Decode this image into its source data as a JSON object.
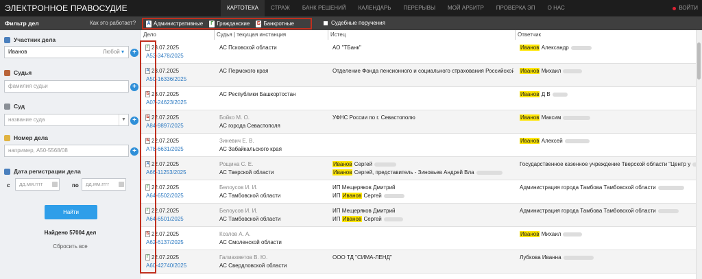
{
  "app": {
    "title": "ЭЛЕКТРОННОЕ ПРАВОСУДИЕ",
    "login": "ВОЙТИ"
  },
  "nav": [
    "КАРТОТЕКА",
    "СТРАЖ",
    "БАНК РЕШЕНИЙ",
    "КАЛЕНДАРЬ",
    "ПЕРЕРЫВЫ",
    "МОЙ АРБИТР",
    "ПРОВЕРКА ЭП",
    "О НАС"
  ],
  "subbar": {
    "filter_title": "Фильтр дел",
    "how_it_works": "Как это работает?",
    "types": [
      {
        "label": "Административные",
        "icon": "А",
        "color": "#2f6fb5"
      },
      {
        "label": "Гражданские",
        "icon": "Г",
        "color": "#3a9a3a"
      },
      {
        "label": "Банкротные",
        "icon": "Б",
        "color": "#c0301f"
      }
    ],
    "court_orders": "Судебные поручения"
  },
  "filters": {
    "participant_label": "Участник дела",
    "participant_value": "Иванов",
    "participant_role": "Любой",
    "judge_label": "Судья",
    "judge_placeholder": "фамилия судьи",
    "court_label": "Суд",
    "court_placeholder": "название суда",
    "case_number_label": "Номер дела",
    "case_number_placeholder": "например, А50-5568/08",
    "reg_date_label": "Дата регистрации дела",
    "from_label": "с",
    "to_label": "по",
    "date_placeholder": "дд.мм.гггг",
    "find_button": "Найти",
    "found_text": "Найдено 57004 дел",
    "reset_text": "Сбросить все"
  },
  "table": {
    "headers": [
      "Дело",
      "Судья | текущая инстанция",
      "Истец",
      "Ответчик"
    ],
    "rows": [
      {
        "type": "Г",
        "date": "23.07.2025",
        "number": "А52-3478/2025",
        "judge": "",
        "court": "АС Псковской области",
        "plaintiff": [
          {
            "pre": "АО \"ТБанк\"",
            "hl": "",
            "post": ""
          }
        ],
        "defendant": [
          {
            "pre": "",
            "hl": "Иванов",
            "post": " Александр"
          }
        ]
      },
      {
        "type": "А",
        "date": "23.07.2025",
        "number": "А50-16336/2025",
        "judge": "",
        "court": "АС Пермского края",
        "plaintiff": [
          {
            "pre": "Отделение Фонда пенсионного и социального страхования Российской",
            "hl": "",
            "post": ""
          }
        ],
        "defendant": [
          {
            "pre": "",
            "hl": "Иванов",
            "post": " Михаил"
          }
        ]
      },
      {
        "type": "Б",
        "date": "23.07.2025",
        "number": "А07-24623/2025",
        "judge": "",
        "court": "АС Республики Башкортостан",
        "plaintiff": [],
        "defendant": [
          {
            "pre": "",
            "hl": "Иванов",
            "post": " Д В"
          }
        ]
      },
      {
        "type": "Б",
        "date": "22.07.2025",
        "number": "А84-9897/2025",
        "judge": "Бойко М. О.",
        "court": "АС города Севастополя",
        "plaintiff": [
          {
            "pre": "УФНС России по г. Севастополю",
            "hl": "",
            "post": ""
          }
        ],
        "defendant": [
          {
            "pre": "",
            "hl": "Иванов",
            "post": " Максим"
          }
        ]
      },
      {
        "type": "Б",
        "date": "22.07.2025",
        "number": "А78-6631/2025",
        "judge": "Зиневич Е. В.",
        "court": "АС Забайкальского края",
        "plaintiff": [],
        "defendant": [
          {
            "pre": "",
            "hl": "Иванов",
            "post": " Алексей"
          }
        ]
      },
      {
        "type": "А",
        "date": "22.07.2025",
        "number": "А66-11253/2025",
        "judge": "Рощина С. Е.",
        "court": "АС Тверской области",
        "plaintiff": [
          {
            "pre": "",
            "hl": "Иванов",
            "post": " Сергей"
          },
          {
            "pre": "",
            "hl": "Иванов",
            "post": " Сергей, представитель - Зиновьев Андрей Вла"
          }
        ],
        "defendant": [
          {
            "pre": "Государственное казенное учреждение Тверской области \"Центр у",
            "hl": "",
            "post": ""
          }
        ]
      },
      {
        "type": "Г",
        "date": "22.07.2025",
        "number": "А64-6502/2025",
        "judge": "Белоусов И. И.",
        "court": "АС Тамбовской области",
        "plaintiff": [
          {
            "pre": "ИП Мещеряков Дмитрий",
            "hl": "",
            "post": ""
          },
          {
            "pre": "ИП ",
            "hl": "Иванов",
            "post": " Сергей"
          }
        ],
        "defendant": [
          {
            "pre": "Администрация города Тамбова Тамбовской области",
            "hl": "",
            "post": ""
          }
        ]
      },
      {
        "type": "Г",
        "date": "22.07.2025",
        "number": "А64-6501/2025",
        "judge": "Белоусов И. И.",
        "court": "АС Тамбовской области",
        "plaintiff": [
          {
            "pre": "ИП Мещеряков Дмитрий",
            "hl": "",
            "post": ""
          },
          {
            "pre": "ИП ",
            "hl": "Иванов",
            "post": " Сергей"
          }
        ],
        "defendant": [
          {
            "pre": "Администрация города Тамбова Тамбовской области",
            "hl": "",
            "post": ""
          }
        ]
      },
      {
        "type": "Б",
        "date": "22.07.2025",
        "number": "А62-6137/2025",
        "judge": "Козлов А. А.",
        "court": "АС Смоленской области",
        "plaintiff": [],
        "defendant": [
          {
            "pre": "",
            "hl": "Иванов",
            "post": " Михаил"
          }
        ]
      },
      {
        "type": "Г",
        "date": "22.07.2025",
        "number": "А60-42740/2025",
        "judge": "Галиахметов В. Ю.",
        "court": "АС Свердловской области",
        "plaintiff": [
          {
            "pre": "ООО ТД \"СИМА-ЛЕНД\"",
            "hl": "",
            "post": ""
          }
        ],
        "defendant": [
          {
            "pre": "Лубкова Иванна",
            "hl": "",
            "post": ""
          }
        ]
      }
    ]
  }
}
